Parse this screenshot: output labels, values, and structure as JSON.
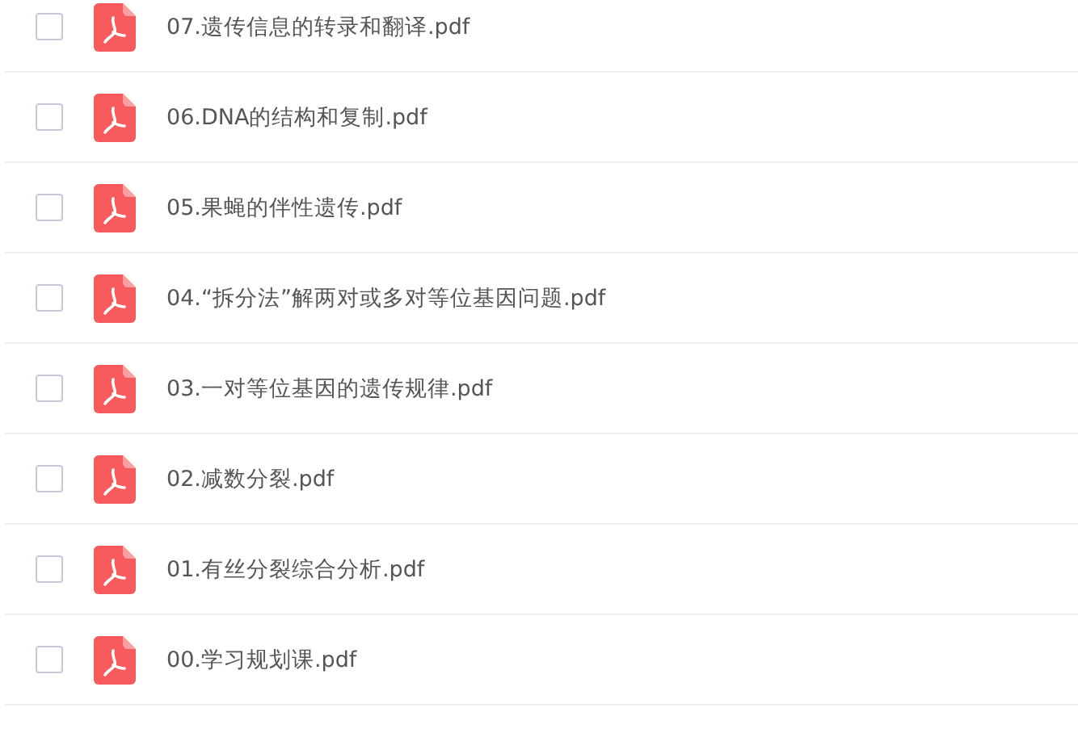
{
  "files": [
    {
      "name": "07.遗传信息的转录和翻译.pdf",
      "checked": false
    },
    {
      "name": "06.DNA的结构和复制.pdf",
      "checked": false
    },
    {
      "name": "05.果蝇的伴性遗传.pdf",
      "checked": false
    },
    {
      "name": "04.“拆分法”解两对或多对等位基因问题.pdf",
      "checked": false
    },
    {
      "name": "03.一对等位基因的遗传规律.pdf",
      "checked": false
    },
    {
      "name": "02.减数分裂.pdf",
      "checked": false
    },
    {
      "name": "01.有丝分裂综合分析.pdf",
      "checked": false
    },
    {
      "name": "00.学习规划课.pdf",
      "checked": false
    }
  ]
}
